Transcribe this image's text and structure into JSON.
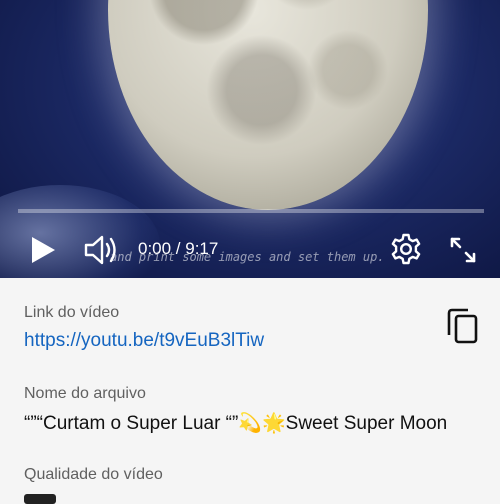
{
  "player": {
    "time": "0:00 / 9:17",
    "subtitle": "and print some images and set them up.",
    "progress_fraction": 0
  },
  "info": {
    "link_label": "Link do vídeo",
    "link_url": "https://youtu.be/t9vEuB3lTiw",
    "filename_label": "Nome do arquivo",
    "filename": "“”“Curtam o Super Luar “”💫🌟Sweet Super Moon",
    "quality_label": "Qualidade do vídeo"
  },
  "icons": {
    "play": "play-icon",
    "volume": "volume-icon",
    "settings": "gear-icon",
    "fullscreen": "fullscreen-icon",
    "copy": "copy-icon"
  },
  "colors": {
    "link": "#1565c0",
    "progress": "#ff0000"
  }
}
